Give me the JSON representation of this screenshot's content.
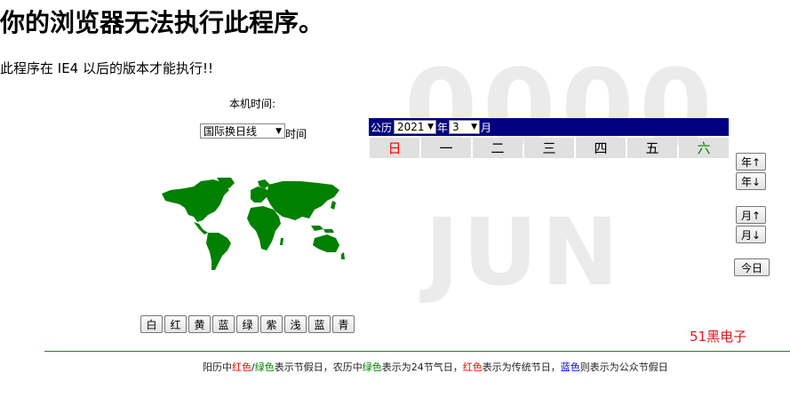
{
  "header": {
    "title": "你的浏览器无法执行此程序。",
    "subtitle": "此程序在 IE4 以后的版本才能执行!!"
  },
  "background": {
    "year": "0000",
    "month": "JUN"
  },
  "clock": {
    "local_time_label": "本机时间:",
    "timezone_selected": "国际换日线",
    "timezone_suffix": "时间"
  },
  "map": {
    "color": "#008000",
    "icon": "world-map-icon"
  },
  "color_buttons": [
    "白",
    "红",
    "黄",
    "蓝",
    "绿",
    "紫",
    "浅",
    "蓝",
    "青"
  ],
  "calendar": {
    "calendar_label": "公历",
    "year_value": "2021",
    "year_suffix": "年",
    "month_value": "3",
    "month_suffix": "月",
    "weekdays": [
      "日",
      "一",
      "二",
      "三",
      "四",
      "五",
      "六"
    ],
    "sunday_color": "#ff0000",
    "saturday_color": "#008000"
  },
  "side_buttons": {
    "year_up": "年↑",
    "year_down": "年↓",
    "month_up": "月↑",
    "month_down": "月↓",
    "today": "今日"
  },
  "brand": "51黑电子",
  "legend": {
    "p1": "阳历中",
    "red1": "红色",
    "slash": "/",
    "green1": "绿色",
    "p2": "表示节假日，农历中",
    "green2": "绿色",
    "p3": "表示为24节气日，",
    "red2": "红色",
    "p4": "表示为传统节日，",
    "blue1": "蓝色",
    "p5": "则表示为公众节假日"
  }
}
